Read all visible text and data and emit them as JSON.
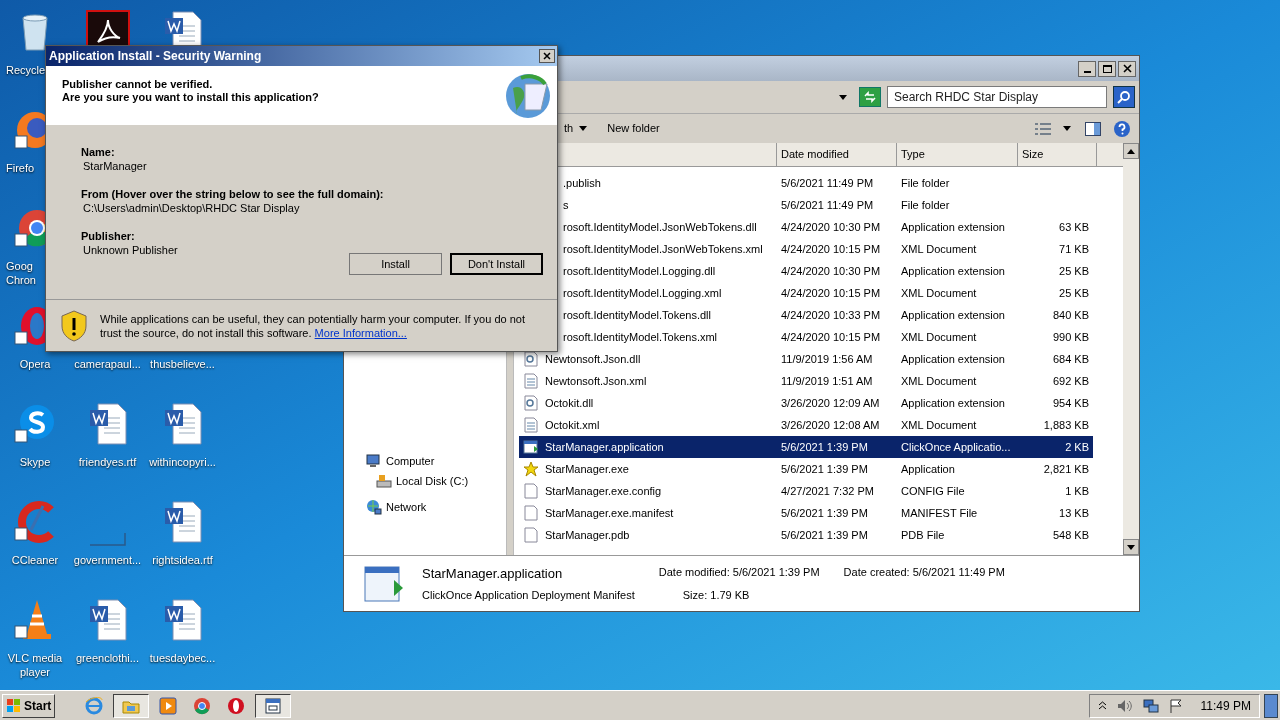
{
  "desktop_icons": [
    {
      "label": [
        "Recycle"
      ],
      "kind": "recycle"
    },
    {
      "kind": "acrobat"
    },
    {
      "kind": "word"
    },
    {
      "label": [
        "Firefo"
      ],
      "kind": "firefox"
    },
    {
      "kind": "empty"
    },
    {
      "kind": "empty"
    },
    {
      "label": [
        "Goog",
        "Chron"
      ],
      "kind": "chrome"
    },
    {
      "kind": "empty"
    },
    {
      "kind": "empty"
    },
    {
      "label": [
        "Opera"
      ],
      "kind": "opera"
    },
    {
      "label": [
        "camerapaul..."
      ],
      "kind": "covered"
    },
    {
      "label": [
        "thusbelieve..."
      ],
      "kind": "covered"
    },
    {
      "label": [
        "Skype"
      ],
      "kind": "skype"
    },
    {
      "label": [
        "friendyes.rtf"
      ],
      "kind": "word"
    },
    {
      "label": [
        "withincopyri..."
      ],
      "kind": "word"
    },
    {
      "label": [
        "CCleaner"
      ],
      "kind": "ccleaner"
    },
    {
      "label": [
        "government..."
      ],
      "kind": "blank"
    },
    {
      "label": [
        "rightsidea.rtf"
      ],
      "kind": "word"
    },
    {
      "label": [
        "VLC media",
        "player"
      ],
      "kind": "vlc"
    },
    {
      "label": [
        "greenclothi..."
      ],
      "kind": "word"
    },
    {
      "label": [
        "tuesdaybec..."
      ],
      "kind": "word"
    }
  ],
  "explorer": {
    "search": {
      "placeholder": "Search RHDC Star Display"
    },
    "toolbar": [
      "th",
      "New folder"
    ],
    "columns": [
      "Date modified",
      "Type",
      "Size"
    ],
    "nav": [
      {
        "label": "Computer",
        "kind": "computer",
        "children": [
          {
            "label": "Local Disk (C:)",
            "kind": "disk"
          }
        ]
      },
      {
        "label": "Network",
        "kind": "network"
      }
    ],
    "files": [
      {
        "name": ".publish",
        "date": "5/6/2021 11:49 PM",
        "type": "File folder",
        "kind": "covered",
        "selected": false
      },
      {
        "name": "s",
        "date": "5/6/2021 11:49 PM",
        "type": "File folder",
        "kind": "covered",
        "selected": false
      },
      {
        "name": "rosoft.IdentityModel.JsonWebTokens.dll",
        "date": "4/24/2020 10:30 PM",
        "type": "Application extension",
        "size": "63 KB",
        "kind": "covered",
        "selected": false
      },
      {
        "name": "rosoft.IdentityModel.JsonWebTokens.xml",
        "date": "4/24/2020 10:15 PM",
        "type": "XML Document",
        "size": "71 KB",
        "kind": "covered",
        "selected": false
      },
      {
        "name": "rosoft.IdentityModel.Logging.dll",
        "date": "4/24/2020 10:30 PM",
        "type": "Application extension",
        "size": "25 KB",
        "kind": "covered",
        "selected": false
      },
      {
        "name": "rosoft.IdentityModel.Logging.xml",
        "date": "4/24/2020 10:15 PM",
        "type": "XML Document",
        "size": "25 KB",
        "kind": "covered",
        "selected": false
      },
      {
        "name": "rosoft.IdentityModel.Tokens.dll",
        "date": "4/24/2020 10:33 PM",
        "type": "Application extension",
        "size": "840 KB",
        "kind": "covered",
        "selected": false
      },
      {
        "name": "rosoft.IdentityModel.Tokens.xml",
        "date": "4/24/2020 10:15 PM",
        "type": "XML Document",
        "size": "990 KB",
        "kind": "covered",
        "selected": false
      },
      {
        "name": "Newtonsoft.Json.dll",
        "date": "11/9/2019 1:56 AM",
        "type": "Application extension",
        "size": "684 KB",
        "kind": "dll",
        "selected": false
      },
      {
        "name": "Newtonsoft.Json.xml",
        "date": "11/9/2019 1:51 AM",
        "type": "XML Document",
        "size": "692 KB",
        "kind": "xml",
        "selected": false
      },
      {
        "name": "Octokit.dll",
        "date": "3/26/2020 12:09 AM",
        "type": "Application extension",
        "size": "954 KB",
        "kind": "dll",
        "selected": false
      },
      {
        "name": "Octokit.xml",
        "date": "3/26/2020 12:08 AM",
        "type": "XML Document",
        "size": "1,883 KB",
        "kind": "xml",
        "selected": false
      },
      {
        "name": "StarManager.application",
        "date": "5/6/2021 1:39 PM",
        "type": "ClickOnce Applicatio...",
        "size": "2 KB",
        "kind": "app",
        "selected": true
      },
      {
        "name": "StarManager.exe",
        "date": "5/6/2021 1:39 PM",
        "type": "Application",
        "size": "2,821 KB",
        "kind": "exe",
        "selected": false
      },
      {
        "name": "StarManager.exe.config",
        "date": "4/27/2021 7:32 PM",
        "type": "CONFIG File",
        "size": "1 KB",
        "kind": "file",
        "selected": false
      },
      {
        "name": "StarManager.exe.manifest",
        "date": "5/6/2021 1:39 PM",
        "type": "MANIFEST File",
        "size": "13 KB",
        "kind": "file",
        "selected": false
      },
      {
        "name": "StarManager.pdb",
        "date": "5/6/2021 1:39 PM",
        "type": "PDB File",
        "size": "548 KB",
        "kind": "file",
        "selected": false
      }
    ],
    "details": {
      "name": "StarManager.application",
      "type": "ClickOnce Application Deployment Manifest",
      "modified_label": "Date modified:",
      "modified": "5/6/2021 1:39 PM",
      "created_label": "Date created:",
      "created": "5/6/2021 11:49 PM",
      "size_label": "Size:",
      "size": "1.79 KB"
    }
  },
  "dialog": {
    "title": "Application Install - Security Warning",
    "headline": [
      "Publisher cannot be verified.",
      "Are you sure you want to install this application?"
    ],
    "fields": [
      {
        "label": "Name:",
        "value": "StarManager"
      },
      {
        "label": "From (Hover over the string below to see the full domain):",
        "value": "C:\\Users\\admin\\Desktop\\RHDC Star Display"
      },
      {
        "label": "Publisher:",
        "value": "Unknown Publisher"
      }
    ],
    "buttons": [
      {
        "label": "Install",
        "default": false
      },
      {
        "label": "Don't Install",
        "default": true
      }
    ],
    "warning": "While applications can be useful, they can potentially harm your computer. If you do not trust the source, do not install this software.",
    "link": "More Information..."
  },
  "taskbar": {
    "start": "Start",
    "items": [
      {
        "kind": "ie",
        "selected": false
      },
      {
        "kind": "folder",
        "selected": true
      },
      {
        "kind": "media",
        "selected": false
      },
      {
        "kind": "chrome",
        "selected": false
      },
      {
        "kind": "opera",
        "selected": false
      },
      {
        "kind": "window",
        "selected": true
      }
    ],
    "clock": "11:49 PM"
  }
}
